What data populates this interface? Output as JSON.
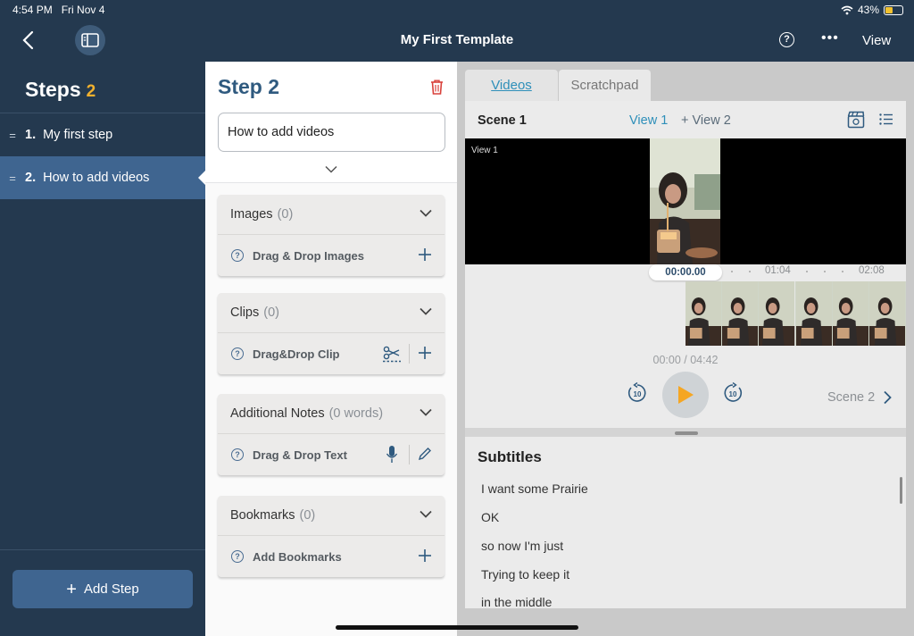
{
  "status": {
    "time": "4:54 PM",
    "date": "Fri Nov 4",
    "battery": "43%"
  },
  "nav": {
    "title": "My First Template",
    "help": "?",
    "more": "•••",
    "view": "View"
  },
  "sidebar": {
    "title": "Steps",
    "count": "2",
    "steps": [
      {
        "num": "1.",
        "label": "My first step"
      },
      {
        "num": "2.",
        "label": "How to add videos"
      }
    ],
    "add_step": "Add Step"
  },
  "step": {
    "header": "Step 2",
    "name_value": "How to add videos",
    "cards": [
      {
        "title": "Images",
        "count": "(0)",
        "action": "Drag & Drop Images"
      },
      {
        "title": "Clips",
        "count": "(0)",
        "action": "Drag&Drop Clip"
      },
      {
        "title": "Additional Notes",
        "count": "(0 words)",
        "action": "Drag & Drop Text"
      },
      {
        "title": "Bookmarks",
        "count": "(0)",
        "action": "Add Bookmarks"
      }
    ]
  },
  "tabs": {
    "videos": "Videos",
    "scratchpad": "Scratchpad"
  },
  "player": {
    "scene": "Scene 1",
    "view1": "View 1",
    "view2": "+ View 2",
    "video_label": "View 1",
    "current_time": "00:00.00",
    "tick1": "01:04",
    "tick2": "02:08",
    "time_ratio": "00:00 / 04:42",
    "next_scene": "Scene 2",
    "skip_seconds": "10"
  },
  "subtitles": {
    "title": "Subtitles",
    "lines": [
      "I want some Prairie",
      "OK",
      "so now I'm just",
      "Trying to keep it",
      "in the middle"
    ]
  },
  "colors": {
    "nav_bg": "#24394f",
    "accent_blue": "#2e8fb9",
    "play_orange": "#f5a623",
    "count_orange": "#f2b12e",
    "trash_red": "#d9413b"
  }
}
